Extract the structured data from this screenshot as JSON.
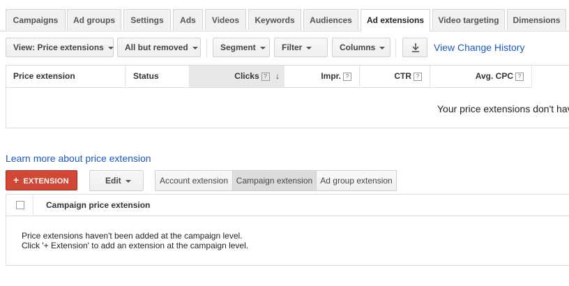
{
  "tabs": [
    {
      "label": "Campaigns"
    },
    {
      "label": "Ad groups"
    },
    {
      "label": "Settings"
    },
    {
      "label": "Ads"
    },
    {
      "label": "Videos"
    },
    {
      "label": "Keywords"
    },
    {
      "label": "Audiences"
    },
    {
      "label": "Ad extensions"
    },
    {
      "label": "Video targeting"
    },
    {
      "label": "Dimensions"
    }
  ],
  "toolbar": {
    "view_label": "View: Price extensions",
    "filter_status": "All but removed",
    "segment": "Segment",
    "filter": "Filter",
    "columns": "Columns",
    "history_link": "View Change History"
  },
  "table1": {
    "columns": [
      "Price extension",
      "Status",
      "Clicks",
      "Impr.",
      "CTR",
      "Avg. CPC"
    ],
    "help_mark": "?",
    "sort_arrow": "↓",
    "empty_message": "Your price extensions don't have"
  },
  "learn_link": "Learn more about price extension",
  "actions": {
    "add_extension": "EXTENSION",
    "plus": "+",
    "edit": "Edit",
    "levels": [
      "Account extension",
      "Campaign extension",
      "Ad group extension"
    ]
  },
  "table2": {
    "column": "Campaign price extension",
    "message_line1": "Price extensions haven't been added at the campaign level.",
    "message_line2": "Click '+ Extension' to add an extension at the campaign level."
  },
  "colors": {
    "accent_red": "#d14836",
    "link_blue": "#1a57c4"
  }
}
